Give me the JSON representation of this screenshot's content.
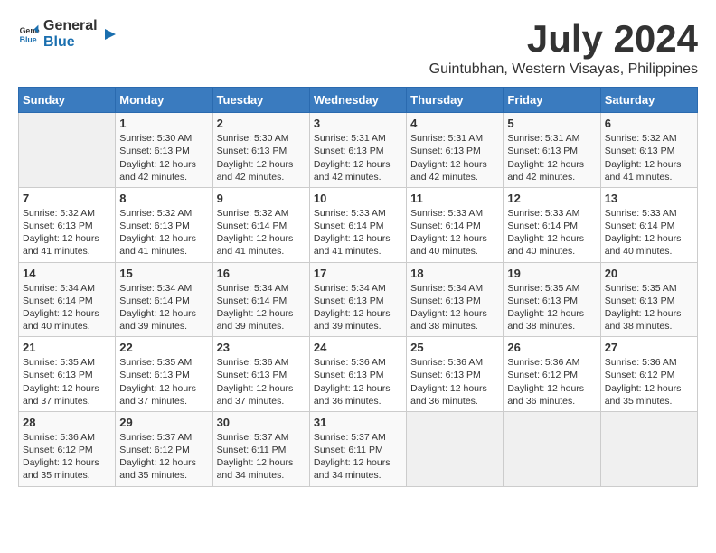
{
  "logo": {
    "general": "General",
    "blue": "Blue"
  },
  "title": "July 2024",
  "location": "Guintubhan, Western Visayas, Philippines",
  "days_header": [
    "Sunday",
    "Monday",
    "Tuesday",
    "Wednesday",
    "Thursday",
    "Friday",
    "Saturday"
  ],
  "weeks": [
    [
      {
        "day": "",
        "info": ""
      },
      {
        "day": "1",
        "info": "Sunrise: 5:30 AM\nSunset: 6:13 PM\nDaylight: 12 hours\nand 42 minutes."
      },
      {
        "day": "2",
        "info": "Sunrise: 5:30 AM\nSunset: 6:13 PM\nDaylight: 12 hours\nand 42 minutes."
      },
      {
        "day": "3",
        "info": "Sunrise: 5:31 AM\nSunset: 6:13 PM\nDaylight: 12 hours\nand 42 minutes."
      },
      {
        "day": "4",
        "info": "Sunrise: 5:31 AM\nSunset: 6:13 PM\nDaylight: 12 hours\nand 42 minutes."
      },
      {
        "day": "5",
        "info": "Sunrise: 5:31 AM\nSunset: 6:13 PM\nDaylight: 12 hours\nand 42 minutes."
      },
      {
        "day": "6",
        "info": "Sunrise: 5:32 AM\nSunset: 6:13 PM\nDaylight: 12 hours\nand 41 minutes."
      }
    ],
    [
      {
        "day": "7",
        "info": "Sunrise: 5:32 AM\nSunset: 6:13 PM\nDaylight: 12 hours\nand 41 minutes."
      },
      {
        "day": "8",
        "info": "Sunrise: 5:32 AM\nSunset: 6:13 PM\nDaylight: 12 hours\nand 41 minutes."
      },
      {
        "day": "9",
        "info": "Sunrise: 5:32 AM\nSunset: 6:14 PM\nDaylight: 12 hours\nand 41 minutes."
      },
      {
        "day": "10",
        "info": "Sunrise: 5:33 AM\nSunset: 6:14 PM\nDaylight: 12 hours\nand 41 minutes."
      },
      {
        "day": "11",
        "info": "Sunrise: 5:33 AM\nSunset: 6:14 PM\nDaylight: 12 hours\nand 40 minutes."
      },
      {
        "day": "12",
        "info": "Sunrise: 5:33 AM\nSunset: 6:14 PM\nDaylight: 12 hours\nand 40 minutes."
      },
      {
        "day": "13",
        "info": "Sunrise: 5:33 AM\nSunset: 6:14 PM\nDaylight: 12 hours\nand 40 minutes."
      }
    ],
    [
      {
        "day": "14",
        "info": "Sunrise: 5:34 AM\nSunset: 6:14 PM\nDaylight: 12 hours\nand 40 minutes."
      },
      {
        "day": "15",
        "info": "Sunrise: 5:34 AM\nSunset: 6:14 PM\nDaylight: 12 hours\nand 39 minutes."
      },
      {
        "day": "16",
        "info": "Sunrise: 5:34 AM\nSunset: 6:14 PM\nDaylight: 12 hours\nand 39 minutes."
      },
      {
        "day": "17",
        "info": "Sunrise: 5:34 AM\nSunset: 6:13 PM\nDaylight: 12 hours\nand 39 minutes."
      },
      {
        "day": "18",
        "info": "Sunrise: 5:34 AM\nSunset: 6:13 PM\nDaylight: 12 hours\nand 38 minutes."
      },
      {
        "day": "19",
        "info": "Sunrise: 5:35 AM\nSunset: 6:13 PM\nDaylight: 12 hours\nand 38 minutes."
      },
      {
        "day": "20",
        "info": "Sunrise: 5:35 AM\nSunset: 6:13 PM\nDaylight: 12 hours\nand 38 minutes."
      }
    ],
    [
      {
        "day": "21",
        "info": "Sunrise: 5:35 AM\nSunset: 6:13 PM\nDaylight: 12 hours\nand 37 minutes."
      },
      {
        "day": "22",
        "info": "Sunrise: 5:35 AM\nSunset: 6:13 PM\nDaylight: 12 hours\nand 37 minutes."
      },
      {
        "day": "23",
        "info": "Sunrise: 5:36 AM\nSunset: 6:13 PM\nDaylight: 12 hours\nand 37 minutes."
      },
      {
        "day": "24",
        "info": "Sunrise: 5:36 AM\nSunset: 6:13 PM\nDaylight: 12 hours\nand 36 minutes."
      },
      {
        "day": "25",
        "info": "Sunrise: 5:36 AM\nSunset: 6:13 PM\nDaylight: 12 hours\nand 36 minutes."
      },
      {
        "day": "26",
        "info": "Sunrise: 5:36 AM\nSunset: 6:12 PM\nDaylight: 12 hours\nand 36 minutes."
      },
      {
        "day": "27",
        "info": "Sunrise: 5:36 AM\nSunset: 6:12 PM\nDaylight: 12 hours\nand 35 minutes."
      }
    ],
    [
      {
        "day": "28",
        "info": "Sunrise: 5:36 AM\nSunset: 6:12 PM\nDaylight: 12 hours\nand 35 minutes."
      },
      {
        "day": "29",
        "info": "Sunrise: 5:37 AM\nSunset: 6:12 PM\nDaylight: 12 hours\nand 35 minutes."
      },
      {
        "day": "30",
        "info": "Sunrise: 5:37 AM\nSunset: 6:11 PM\nDaylight: 12 hours\nand 34 minutes."
      },
      {
        "day": "31",
        "info": "Sunrise: 5:37 AM\nSunset: 6:11 PM\nDaylight: 12 hours\nand 34 minutes."
      },
      {
        "day": "",
        "info": ""
      },
      {
        "day": "",
        "info": ""
      },
      {
        "day": "",
        "info": ""
      }
    ]
  ]
}
